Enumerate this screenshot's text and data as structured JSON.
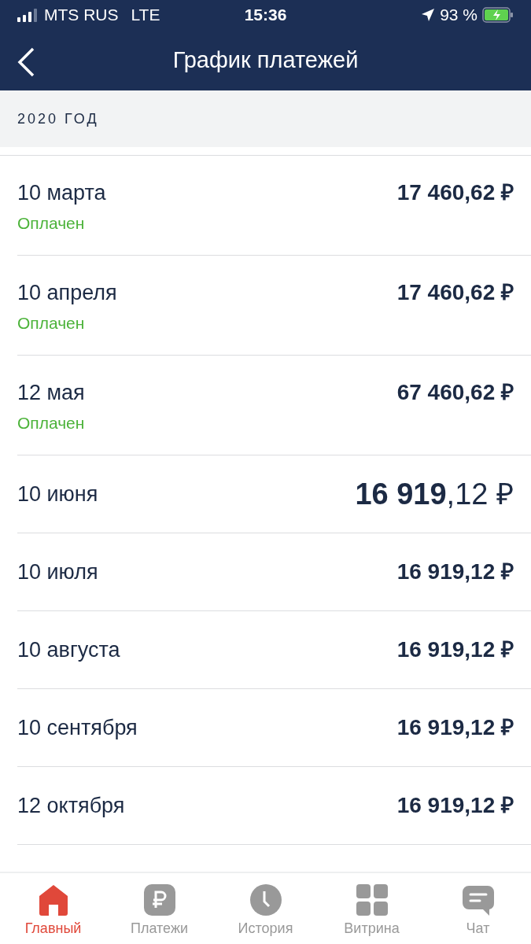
{
  "status_bar": {
    "carrier": "MTS RUS",
    "network": "LTE",
    "time": "15:36",
    "battery": "93 %"
  },
  "header": {
    "title": "График платежей"
  },
  "section": {
    "title": "2020 ГОД"
  },
  "payments": [
    {
      "date": "10 марта",
      "amount": "17 460,62 ₽",
      "status": "Оплачен",
      "selected": false
    },
    {
      "date": "10 апреля",
      "amount": "17 460,62 ₽",
      "status": "Оплачен",
      "selected": false
    },
    {
      "date": "12 мая",
      "amount": "67 460,62 ₽",
      "status": "Оплачен",
      "selected": false
    },
    {
      "date": "10 июня",
      "amount": "**16 919**,12 ₽",
      "selected": true
    },
    {
      "date": "10 июля",
      "amount": "16 919,12 ₽",
      "selected": false
    },
    {
      "date": "10 августа",
      "amount": "16 919,12 ₽",
      "selected": false
    },
    {
      "date": "10 сентября",
      "amount": "16 919,12 ₽",
      "selected": false
    },
    {
      "date": "12 октября",
      "amount": "16 919,12 ₽",
      "selected": false
    }
  ],
  "tab_bar": [
    {
      "kind": "home",
      "label": "Главный",
      "selected": true
    },
    {
      "kind": "ruble",
      "label": "Платежи",
      "selected": false
    },
    {
      "kind": "clock",
      "label": "История",
      "selected": false
    },
    {
      "kind": "grid",
      "label": "Витрина",
      "selected": false
    },
    {
      "kind": "chat",
      "label": "Чат",
      "selected": false
    }
  ]
}
